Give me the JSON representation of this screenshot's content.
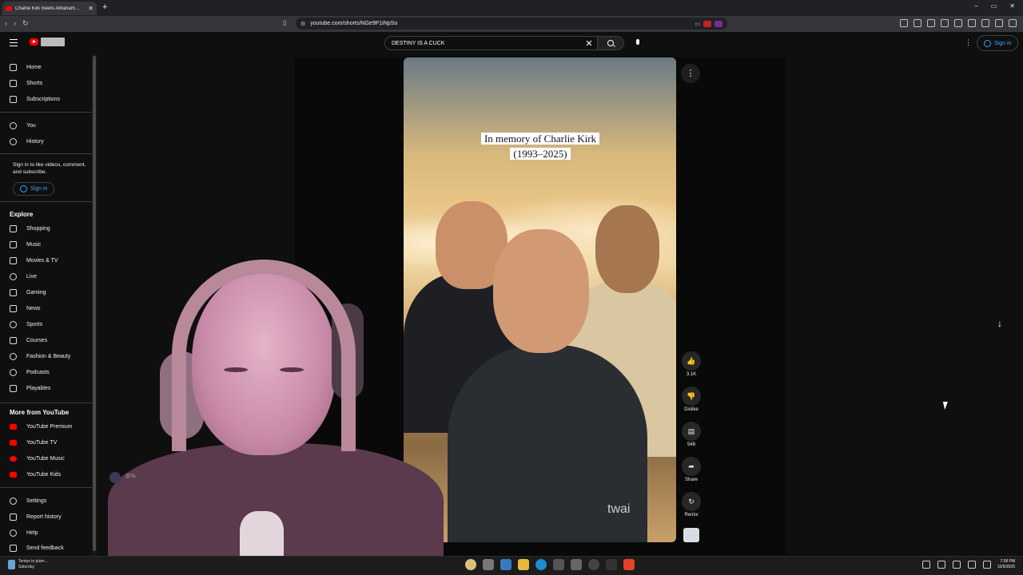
{
  "browser": {
    "tab_title": "Charlie Kirk meets Abraham…",
    "tab_close": "✕",
    "new_tab": "+",
    "url": "youtube.com/shorts/NGe9P1iNpSo",
    "window_controls": [
      "–",
      "▭",
      "✕"
    ]
  },
  "masthead": {
    "search_value": "DESTINY IS A CUCK",
    "search_clear": "✕",
    "menu_dots": "⋮",
    "signin_label": "Sign in"
  },
  "sidebar": {
    "main": [
      {
        "label": "Home",
        "icon": "home-icon"
      },
      {
        "label": "Shorts",
        "icon": "shorts-icon"
      },
      {
        "label": "Subscriptions",
        "icon": "subscriptions-icon"
      }
    ],
    "you": [
      {
        "label": "You",
        "icon": "you-icon"
      },
      {
        "label": "History",
        "icon": "history-icon"
      }
    ],
    "signin_message": "Sign in to like videos, comment, and subscribe.",
    "signin_button": "Sign in",
    "explore_title": "Explore",
    "explore": [
      {
        "label": "Shopping",
        "icon": "shopping-icon"
      },
      {
        "label": "Music",
        "icon": "music-icon"
      },
      {
        "label": "Movies & TV",
        "icon": "movies-icon"
      },
      {
        "label": "Live",
        "icon": "live-icon"
      },
      {
        "label": "Gaming",
        "icon": "gaming-icon"
      },
      {
        "label": "News",
        "icon": "news-icon"
      },
      {
        "label": "Sports",
        "icon": "sports-icon"
      },
      {
        "label": "Courses",
        "icon": "courses-icon"
      },
      {
        "label": "Fashion & Beauty",
        "icon": "fashion-icon"
      },
      {
        "label": "Podcasts",
        "icon": "podcasts-icon"
      },
      {
        "label": "Playables",
        "icon": "playables-icon"
      }
    ],
    "more_title": "More from YouTube",
    "more": [
      {
        "label": "YouTube Premium",
        "icon": "youtube-premium-icon"
      },
      {
        "label": "YouTube TV",
        "icon": "youtube-tv-icon"
      },
      {
        "label": "YouTube Music",
        "icon": "youtube-music-icon"
      },
      {
        "label": "YouTube Kids",
        "icon": "youtube-kids-icon"
      }
    ],
    "footer": [
      {
        "label": "Settings",
        "icon": "settings-icon"
      },
      {
        "label": "Report history",
        "icon": "report-icon"
      },
      {
        "label": "Help",
        "icon": "help-icon"
      },
      {
        "label": "Send feedback",
        "icon": "feedback-icon"
      }
    ]
  },
  "short": {
    "caption_line1": "In memory of Charlie Kirk",
    "caption_line2": "(1993–2025)",
    "watermark": "twai",
    "more_button": "⋮",
    "actions": [
      {
        "label": "3.1K",
        "icon": "like-icon",
        "glyph": "👍"
      },
      {
        "label": "Dislike",
        "icon": "dislike-icon",
        "glyph": "👎"
      },
      {
        "label": "548",
        "icon": "comments-icon",
        "glyph": "▤"
      },
      {
        "label": "Share",
        "icon": "share-icon",
        "glyph": "➦"
      },
      {
        "label": "Remix",
        "icon": "remix-icon",
        "glyph": "↻"
      }
    ],
    "next_arrow": "↓"
  },
  "overlay": {
    "handle": "@Te"
  },
  "taskbar": {
    "weather_line1": "Temps to plum…",
    "weather_line2": "Saturday",
    "time": "7:38 PM",
    "date": "10/6/2025"
  },
  "colors": {
    "accent_link": "#3ea6ff",
    "youtube_red": "#ff0000",
    "background": "#0f0f0f"
  }
}
